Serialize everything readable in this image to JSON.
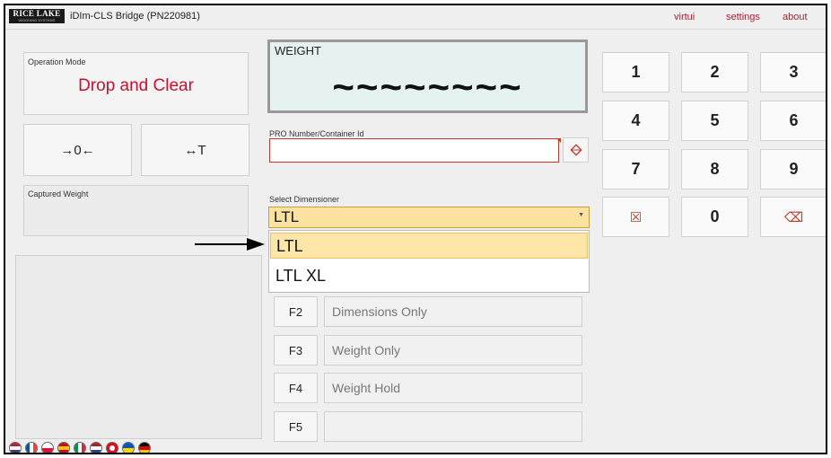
{
  "header": {
    "logo_main": "RICE LAKE",
    "logo_sub": "WEIGHING SYSTEMS",
    "title": "iDIm-CLS Bridge (PN220981)",
    "links": [
      "virtui",
      "settings",
      "about"
    ]
  },
  "operation_mode": {
    "label": "Operation Mode",
    "value": "Drop and Clear"
  },
  "buttons": {
    "zero_icon": "→0←",
    "tare_icon": "↔T"
  },
  "captured_weight": {
    "label": "Captured Weight"
  },
  "weight": {
    "label": "WEIGHT",
    "value": "~~~~~~~~"
  },
  "pro": {
    "label": "PRO Number/Container Id",
    "value": ""
  },
  "dimensioner": {
    "label": "Select Dimensioner",
    "selected": "LTL",
    "options": [
      "LTL",
      "LTL XL"
    ]
  },
  "function_keys": [
    {
      "key": "F2",
      "label": "Dimensions Only"
    },
    {
      "key": "F3",
      "label": "Weight Only"
    },
    {
      "key": "F4",
      "label": "Weight Hold"
    },
    {
      "key": "F5",
      "label": ""
    }
  ],
  "keypad": {
    "digits": [
      "1",
      "2",
      "3",
      "4",
      "5",
      "6",
      "7",
      "8",
      "9",
      "0"
    ],
    "clear_icon": "☒",
    "backspace_icon": "⌫"
  },
  "languages": [
    "English (US)",
    "French",
    "Polish",
    "Spanish",
    "Italian",
    "Dutch",
    "Turkish",
    "Ukrainian",
    "German"
  ],
  "colors": {
    "accent": "#c8102e",
    "select_bg": "#fbe2a0",
    "weight_bg": "#e6f2f2"
  }
}
